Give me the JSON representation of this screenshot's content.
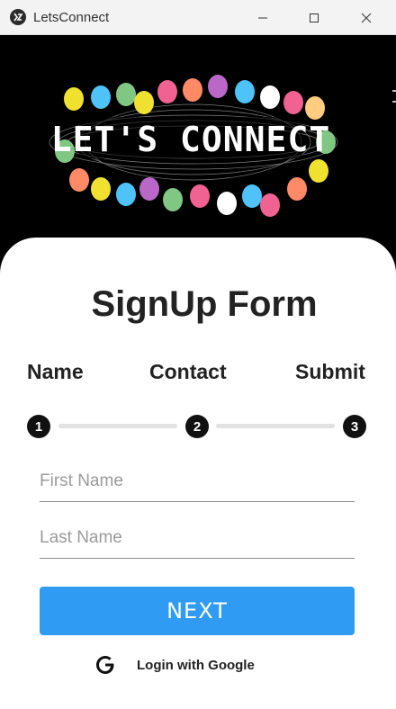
{
  "window": {
    "title": "LetsConnect",
    "app_icon": "kivy-icon",
    "controls": [
      "minimize-icon",
      "maximize-icon",
      "close-icon"
    ]
  },
  "banner": {
    "logo_text": "LET'S CONNECT",
    "colors": [
      "#f0e130",
      "#4fc3f7",
      "#f06292",
      "#81c784",
      "#ff8a65",
      "#ba68c8",
      "#ffffff"
    ]
  },
  "form": {
    "title": "SignUp Form",
    "steps": [
      {
        "label": "Name",
        "number": "1"
      },
      {
        "label": "Contact",
        "number": "2"
      },
      {
        "label": "Submit",
        "number": "3"
      }
    ],
    "first_name": {
      "placeholder": "First Name",
      "value": ""
    },
    "last_name": {
      "placeholder": "Last Name",
      "value": ""
    },
    "next_label": "NEXT",
    "google_label": "Login with Google"
  },
  "colors": {
    "accent": "#2f9bf3",
    "card": "#ffffff",
    "background": "#000000"
  }
}
